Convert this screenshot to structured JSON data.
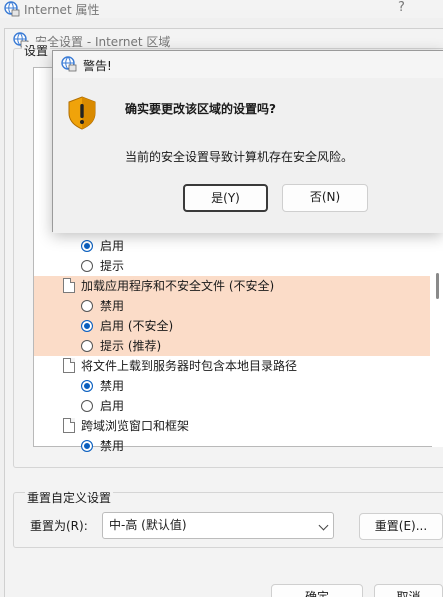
{
  "outer_window": {
    "title": "Internet 属性",
    "help": "?"
  },
  "security_window": {
    "title": "安全设置 - Internet 区域",
    "settings_label": "设置"
  },
  "settings_list": [
    {
      "kind": "option",
      "label": "启用",
      "checked": true
    },
    {
      "kind": "option",
      "label": "提示",
      "checked": false
    },
    {
      "kind": "category",
      "label": "加载应用程序和不安全文件 (不安全)",
      "highlight": true
    },
    {
      "kind": "option",
      "label": "禁用",
      "checked": false,
      "highlight": true
    },
    {
      "kind": "option",
      "label": "启用 (不安全)",
      "checked": true,
      "highlight": true
    },
    {
      "kind": "option",
      "label": "提示 (推荐)",
      "checked": false,
      "highlight": true
    },
    {
      "kind": "category",
      "label": "将文件上载到服务器时包含本地目录路径"
    },
    {
      "kind": "option",
      "label": "禁用",
      "checked": true
    },
    {
      "kind": "option",
      "label": "启用",
      "checked": false
    },
    {
      "kind": "category",
      "label": "跨域浏览窗口和框架"
    },
    {
      "kind": "option",
      "label": "禁用",
      "checked": true
    }
  ],
  "reset": {
    "group_label": "重置自定义设置",
    "reset_to_label": "重置为(R):",
    "selected_level": "中-高 (默认值)",
    "reset_button": "重置(E)..."
  },
  "footer": {
    "ok": "确定",
    "cancel": "取消"
  },
  "warning_dialog": {
    "title": "警告!",
    "question": "确实要更改该区域的设置吗?",
    "message": "当前的安全设置导致计算机存在安全风险。",
    "yes": "是(Y)",
    "no": "否(N)"
  },
  "colors": {
    "highlight": "#fbdcc8",
    "radio_on": "#0a5fbf",
    "warning": "#f0a30a"
  }
}
